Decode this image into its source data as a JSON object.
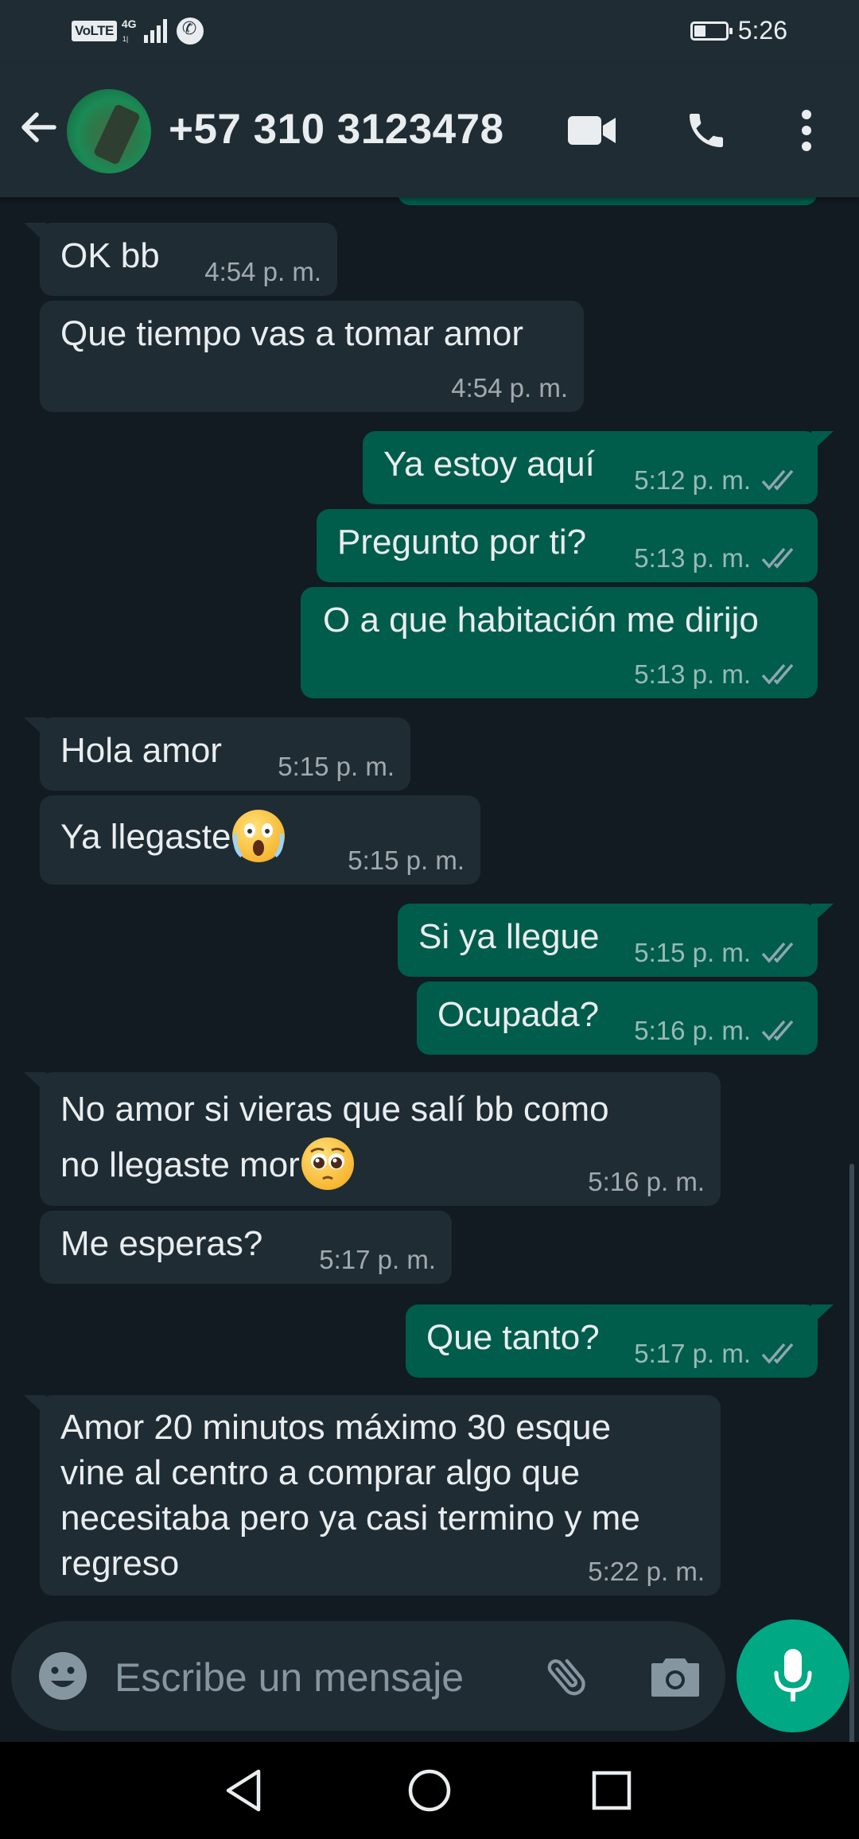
{
  "status_bar": {
    "volte": "VoLTE",
    "network": "4G",
    "network_sub": "1|",
    "time": "5:26",
    "battery_level": 0.35
  },
  "header": {
    "contact": "+57 310 3123478",
    "icons": [
      "back-arrow-icon",
      "video-call-icon",
      "voice-call-icon",
      "more-vert-icon"
    ]
  },
  "messages": [
    {
      "dir": "in",
      "text": "OK bb",
      "time": "4:54 p. m."
    },
    {
      "dir": "in",
      "text": "Que tiempo vas a tomar amor",
      "time": "4:54 p. m."
    },
    {
      "dir": "out",
      "text": "Ya estoy aquí",
      "time": "5:12 p. m.",
      "status": "read"
    },
    {
      "dir": "out",
      "text": "Pregunto por ti?",
      "time": "5:13 p. m.",
      "status": "read"
    },
    {
      "dir": "out",
      "text": "O a que habitación me dirijo",
      "time": "5:13 p. m.",
      "status": "read"
    },
    {
      "dir": "in",
      "text": "Hola amor",
      "time": "5:15 p. m."
    },
    {
      "dir": "in",
      "text": "Ya llegaste",
      "time": "5:15 p. m.",
      "emoji": "face-screaming-in-fear"
    },
    {
      "dir": "out",
      "text": "Si ya llegue",
      "time": "5:15 p. m.",
      "status": "read"
    },
    {
      "dir": "out",
      "text": "Ocupada?",
      "time": "5:16 p. m.",
      "status": "read"
    },
    {
      "dir": "in",
      "lines": [
        "No amor si vieras que salí bb como",
        "no llegaste mor"
      ],
      "time": "5:16 p. m.",
      "emoji": "pleading-face"
    },
    {
      "dir": "in",
      "text": "Me esperas?",
      "time": "5:17 p. m."
    },
    {
      "dir": "out",
      "text": "Que tanto?",
      "time": "5:17 p. m.",
      "status": "read"
    },
    {
      "dir": "in",
      "lines": [
        "Amor 20 minutos máximo 30 esque",
        "vine al centro a comprar algo que",
        "necesitaba pero ya casi termino y me",
        "regreso"
      ],
      "time": "5:22 p. m."
    }
  ],
  "input": {
    "placeholder": "Escribe un mensaje",
    "icons": [
      "emoji-icon",
      "attach-icon",
      "camera-icon",
      "mic-icon"
    ]
  },
  "nav": {
    "icons": [
      "nav-back-icon",
      "nav-home-icon",
      "nav-recents-icon"
    ]
  },
  "colors": {
    "background": "#121b22",
    "header": "#1f2c34",
    "incoming": "#1f2c34",
    "outgoing": "#005c4b",
    "accent": "#00a884",
    "read_ticks": "#8fa6b1"
  }
}
